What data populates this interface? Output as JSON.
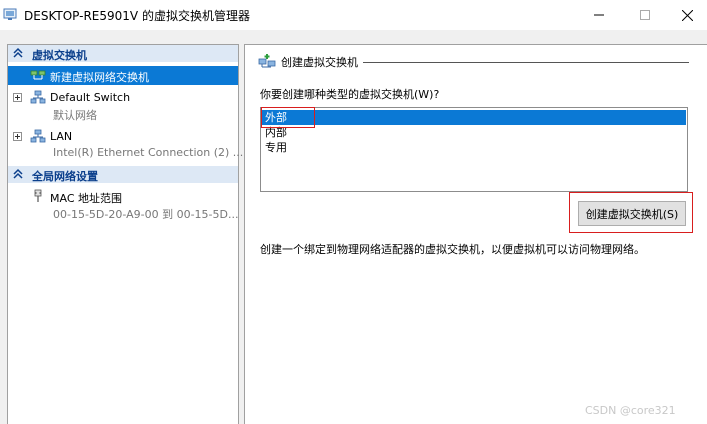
{
  "window": {
    "title": "DESKTOP-RE5901V 的虚拟交换机管理器"
  },
  "sidebar": {
    "sections": [
      {
        "label": "虚拟交换机",
        "icon": "chevron-up-icon"
      },
      {
        "label": "全局网络设置",
        "icon": "chevron-up-icon"
      }
    ],
    "items": [
      {
        "label": "新建虚拟网络交换机",
        "selected": true,
        "icon": "new-switch-icon"
      },
      {
        "label": "Default Switch",
        "sub": "默认网络",
        "icon": "network-icon"
      },
      {
        "label": "LAN",
        "sub": "Intel(R) Ethernet Connection (2) ...",
        "icon": "network-icon"
      },
      {
        "label": "MAC 地址范围",
        "sub": "00-15-5D-20-A9-00 到 00-15-5D...",
        "icon": "mac-range-icon"
      }
    ]
  },
  "panel": {
    "title": "创建虚拟交换机",
    "question": "你要创建哪种类型的虚拟交换机(W)?",
    "options": [
      "外部",
      "内部",
      "专用"
    ],
    "selected_option": "外部",
    "create_button": "创建虚拟交换机(S)",
    "description": "创建一个绑定到物理网络适配器的虚拟交换机，以便虚拟机可以访问物理网络。"
  },
  "watermark": "CSDN @core321",
  "colors": {
    "selection": "#0b79d5",
    "section_header_bg": "#dde8f5",
    "section_header_text": "#0b3f8c",
    "highlight_box": "#d81e1e"
  }
}
